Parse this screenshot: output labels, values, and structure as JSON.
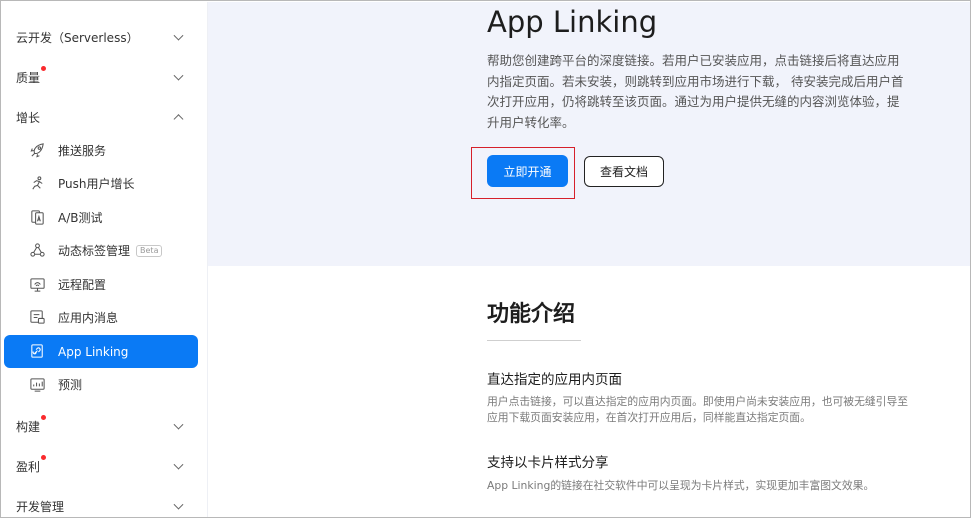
{
  "sidebar": {
    "groups": {
      "cloud": {
        "label": "云开发（Serverless）",
        "state": "collapsed"
      },
      "quality": {
        "label": "质量",
        "badge": true,
        "state": "collapsed"
      },
      "growth": {
        "label": "增长",
        "state": "expanded"
      },
      "build": {
        "label": "构建",
        "badge": true,
        "state": "collapsed"
      },
      "earn": {
        "label": "盈利",
        "badge": true,
        "state": "collapsed"
      },
      "devmgmt": {
        "label": "开发管理",
        "state": "collapsed"
      }
    },
    "growth_items": [
      {
        "label": "推送服务",
        "icon": "rocket-icon"
      },
      {
        "label": "Push用户增长",
        "icon": "runner-icon"
      },
      {
        "label": "A/B测试",
        "icon": "ab-test-icon"
      },
      {
        "label": "动态标签管理",
        "icon": "tag-nodes-icon",
        "tag": "Beta"
      },
      {
        "label": "远程配置",
        "icon": "remote-config-icon"
      },
      {
        "label": "应用内消息",
        "icon": "in-app-message-icon"
      },
      {
        "label": "App Linking",
        "icon": "app-linking-icon",
        "active": true
      },
      {
        "label": "预测",
        "icon": "forecast-icon"
      }
    ]
  },
  "hero": {
    "title": "App Linking",
    "description": "帮助您创建跨平台的深度链接。若用户已安装应用，点击链接后将直达应用内指定页面。若未安装，则跳转到应用市场进行下载， 待安装完成后用户首次打开应用，仍将跳转至该页面。通过为用户提供无缝的内容浏览体验，提升用户转化率。",
    "primary_button": "立即开通",
    "secondary_button": "查看文档"
  },
  "features": {
    "title": "功能介绍",
    "items": [
      {
        "title": "直达指定的应用内页面",
        "desc": "用户点击链接，可以直达指定的应用内页面。即使用户尚未安装应用，也可被无缝引导至应用下载页面安装应用，在首次打开应用后，同样能直达指定页面。"
      },
      {
        "title": "支持以卡片样式分享",
        "desc": "App Linking的链接在社交软件中可以呈现为卡片样式，实现更加丰富图文效果。"
      }
    ]
  },
  "colors": {
    "accent": "#0a7af5",
    "badge": "#fa2a2d",
    "highlight": "#d6202a",
    "hero_bg": "#f1f3fb"
  }
}
